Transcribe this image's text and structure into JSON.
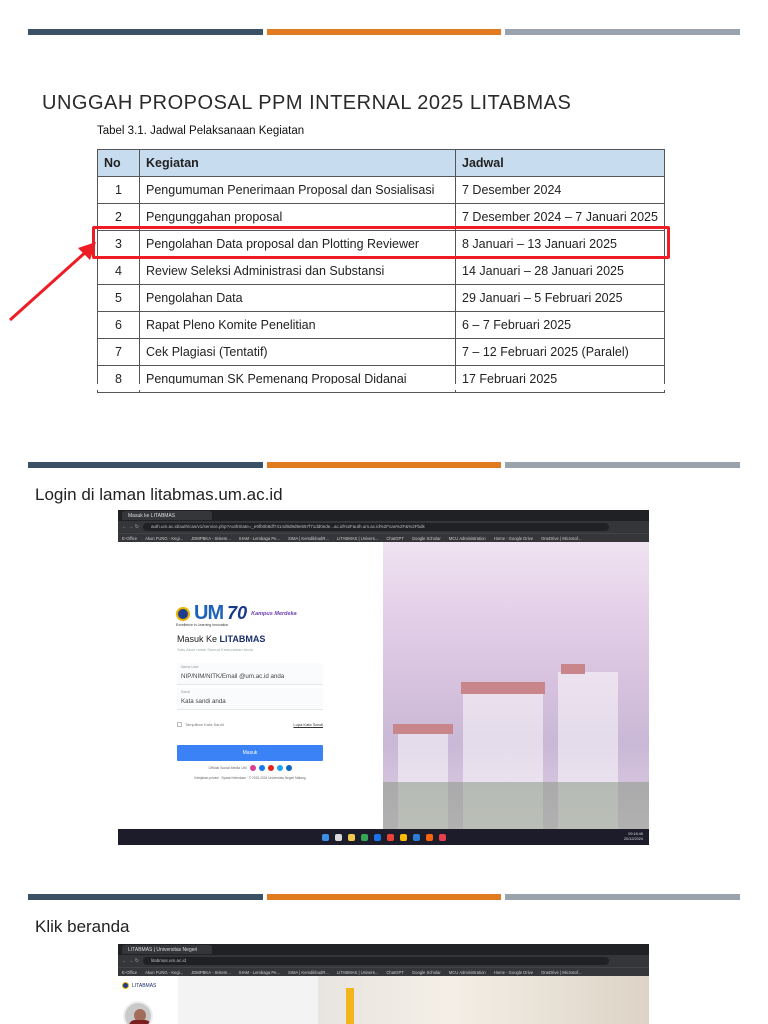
{
  "slide1": {
    "title": "UNGGAH PROPOSAL PPM INTERNAL 2025 LITABMAS",
    "caption": "Tabel 3.1. Jadwal Pelaksanaan Kegiatan",
    "headers": {
      "no": "No",
      "kegiatan": "Kegiatan",
      "jadwal": "Jadwal"
    },
    "rows": [
      {
        "no": "1",
        "kegiatan": "Pengumuman Penerimaan Proposal dan Sosialisasi",
        "jadwal": "7 Desember 2024"
      },
      {
        "no": "2",
        "kegiatan": "Pengunggahan proposal",
        "jadwal": "7 Desember 2024 –  7 Januari 2025"
      },
      {
        "no": "3",
        "kegiatan": "Pengolahan Data proposal dan Plotting Reviewer",
        "jadwal": "8 Januari – 13 Januari 2025"
      },
      {
        "no": "4",
        "kegiatan": "Review Seleksi Administrasi dan Substansi",
        "jadwal": "14 Januari – 28 Januari 2025"
      },
      {
        "no": "5",
        "kegiatan": "Pengolahan Data",
        "jadwal": "29 Januari – 5 Februari 2025"
      },
      {
        "no": "6",
        "kegiatan": "Rapat Pleno Komite Penelitian",
        "jadwal": "6 – 7 Februari 2025"
      },
      {
        "no": "7",
        "kegiatan": "Cek Plagiasi (Tentatif)",
        "jadwal": "7 – 12 Februari 2025 (Paralel)"
      },
      {
        "no": "8",
        "kegiatan": "Pengumuman SK Pemenang Proposal Didanai",
        "jadwal": "17 Februari 2025"
      }
    ]
  },
  "slide2": {
    "label": "Login di laman litabmas.um.ac.id",
    "browser": {
      "tab_title": "Masuk ke LITABMAS",
      "url": "auth.um.ac.id/auth/cas/v1/service.php?AuthState=_e9fb0b8df7414d9d9d9e557f71dd0ede...ac.id%2Fauth.um.ac.id%2Fcas%2F&%2Fbdk",
      "bookmarks": [
        "E-Office",
        "Akun FUNG - Kegi...",
        "JDMPBKA - Sistem...",
        "SIAM - Lembaga Pe...",
        "SIMA | KemdikbudR...",
        "LITABMAS | Univers...",
        "ChatGPT",
        "Google Scholar",
        "MCU Administration",
        "Home - Google Drive",
        "OneDrive | Microsof..."
      ],
      "profile": "Incognito"
    },
    "login": {
      "brand_um": "UM",
      "brand_70": "70",
      "kampus": "Kampus Merdeka",
      "tagline": "Excellence in Learning Innovation",
      "title_prefix": "Masuk Ke ",
      "title_brand": "LITABMAS",
      "subtitle": "Satu Akun untuk Semua Kemudahan Anda",
      "user_label": "Nama User",
      "user_placeholder": "NIP/NIM/NITK/Email @um.ac.id anda",
      "pass_label": "Sandi",
      "pass_placeholder": "Kata sandi anda",
      "show_password": "Tampilkan Kata Sandi",
      "forgot": "Lupa Kata Sandi",
      "submit": "Masuk",
      "social_label": "Official Social Media UM",
      "footer": "Kebijakan privasi · Syarat Ketentuan · © 2015-2024 Universitas Negeri Malang"
    },
    "tray": {
      "time": "09:18:46",
      "date": "20/12/2024"
    }
  },
  "slide3": {
    "label": "Klik beranda",
    "browser": {
      "tab_title": "LITABMAS | Universitas Negeri",
      "url": "litabmas.um.ac.id",
      "profile": "Incognito"
    },
    "side_logo": "LITABMAS"
  },
  "colors": {
    "bar1": "#3b5266",
    "bar2": "#e07b1f",
    "bar3": "#9aa3ab",
    "highlight": "#ee1c25",
    "header_bg": "#c8dcf0",
    "button": "#3b82f6"
  }
}
